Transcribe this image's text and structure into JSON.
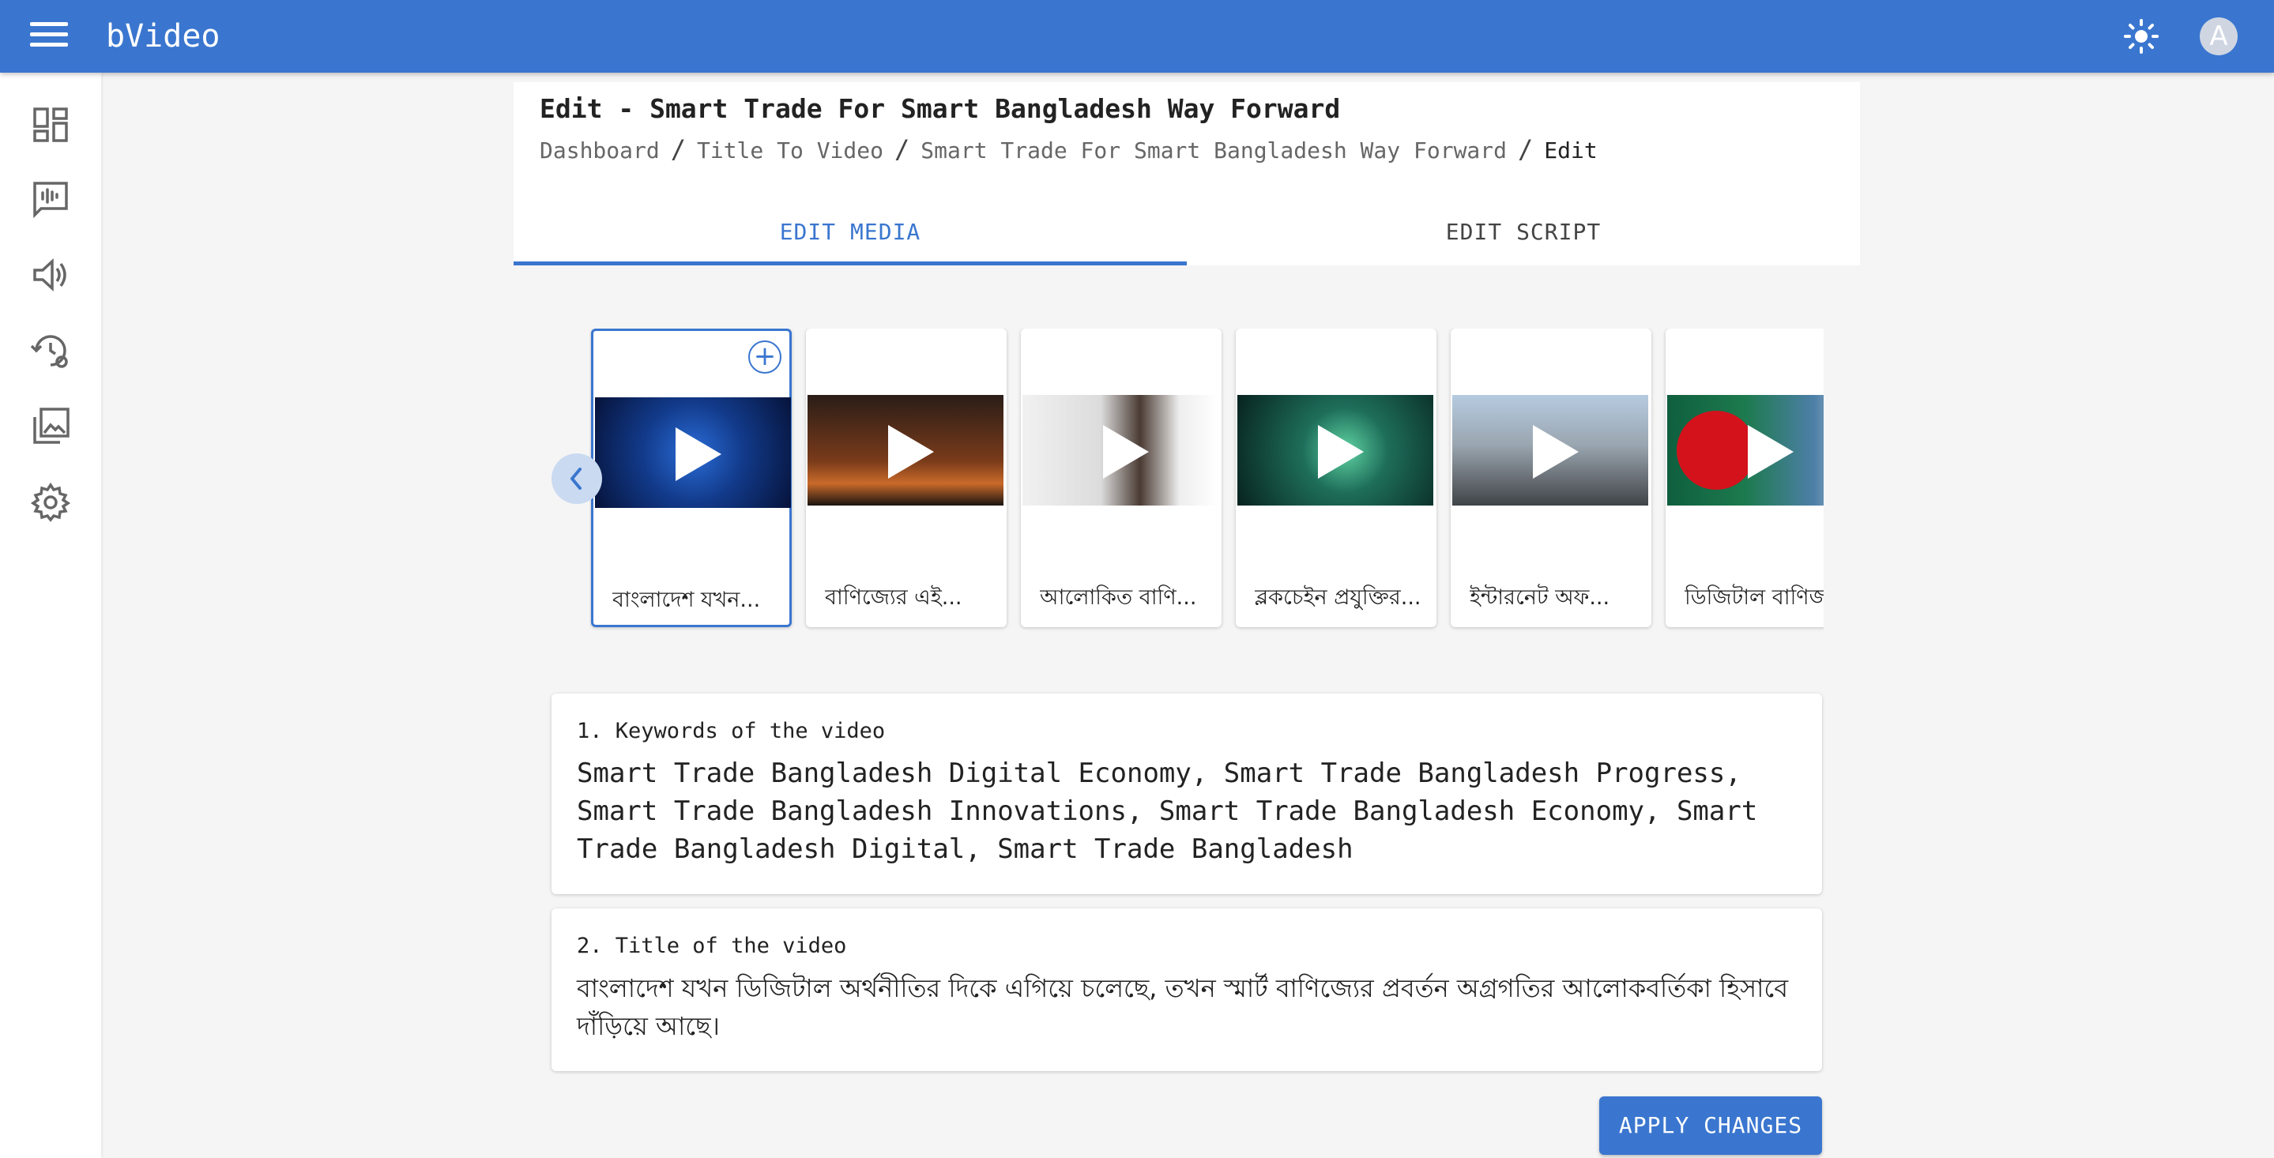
{
  "app": {
    "title": "bVideo",
    "avatar_letter": "A"
  },
  "sidebar": {
    "items": [
      {
        "icon": "dashboard-icon"
      },
      {
        "icon": "voice-chat-icon"
      },
      {
        "icon": "speaker-icon"
      },
      {
        "icon": "history-settings-icon"
      },
      {
        "icon": "gallery-icon"
      },
      {
        "icon": "settings-icon"
      }
    ]
  },
  "header": {
    "title": "Edit - Smart Trade For Smart Bangladesh Way Forward",
    "breadcrumb": {
      "item1": "Dashboard",
      "item2": "Title To Video",
      "item3": "Smart Trade For Smart Bangladesh Way Forward",
      "current": "Edit",
      "separator": "/"
    }
  },
  "tabs": {
    "edit_media": "EDIT MEDIA",
    "edit_script": "EDIT SCRIPT"
  },
  "media": {
    "add_symbol": "+",
    "cards": [
      {
        "label": "বাংলাদেশ যখন...",
        "selected": true
      },
      {
        "label": "বাণিজ্যের এই..."
      },
      {
        "label": "আলোকিত বাণি..."
      },
      {
        "label": "ব্লকচেইন প্রযুক্তির..."
      },
      {
        "label": "ইন্টারনেট অফ..."
      },
      {
        "label": "ডিজিটাল বাণিজ্য"
      }
    ]
  },
  "panels": {
    "keywords": {
      "label": "1. Keywords of the video",
      "value": "Smart Trade Bangladesh Digital Economy, Smart Trade Bangladesh Progress, Smart Trade Bangladesh Innovations, Smart Trade Bangladesh Economy, Smart Trade Bangladesh Digital, Smart Trade Bangladesh"
    },
    "title": {
      "label": "2. Title of the video",
      "value": "বাংলাদেশ যখন ডিজিটাল অর্থনীতির দিকে এগিয়ে চলেছে, তখন স্মার্ট বাণিজ্যের প্রবর্তন অগ্রগতির আলোকবর্তিকা হিসাবে দাঁড়িয়ে আছে।"
    }
  },
  "apply_button": "APPLY CHANGES",
  "colors": {
    "primary": "#3a76cf",
    "background": "#f5f5f5"
  }
}
